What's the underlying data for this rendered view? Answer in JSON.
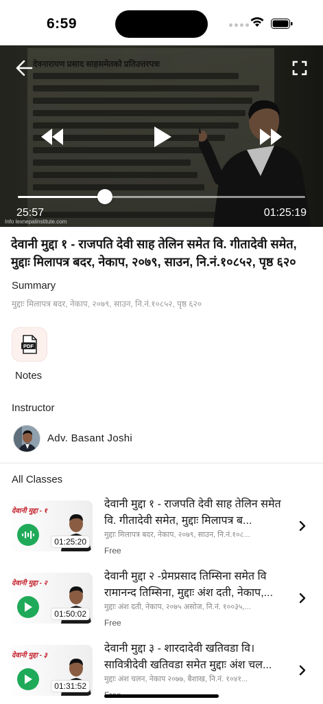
{
  "status_bar": {
    "time": "6:59"
  },
  "player": {
    "current_time": "25:57",
    "total_time": "01:25:19",
    "progress": 0.304,
    "watermark": "Info lexnepalinstitute.com",
    "doc_heading": "देवनारायण प्रसाद साहसमेतको प्रतिउत्तरपत्रः"
  },
  "lesson": {
    "title": "देवानी मुद्दा १ - राजपति देवी साह तेलिन समेत वि. गीतादेवी समेत, मुद्दाः मिलापत्र बदर, नेकाप, २०७९, साउन, नि.नं.१०८५२, पृष्ठ ६२०",
    "summary_label": "Summary",
    "summary_text": "मुद्दाः मिलापत्र बदर, नेकाप, २०७९, साउन, नि.नं.१०८५२, पृष्ठ ६२०",
    "notes_label": "Notes",
    "notes_icon": "pdf-icon",
    "instructor_label": "Instructor",
    "instructor_name": "Adv. Basant Joshi"
  },
  "all_classes": {
    "label": "All Classes",
    "items": [
      {
        "thumb_title": "देवानी मुद्दा - १",
        "duration": "01:25:20",
        "title": "देवानी मुद्दा १ - राजपति देवी साह तेलिन समेत वि. गीतादेवी समेत, मुद्दाः मिलापत्र ब...",
        "meta": "मुद्दाः मिलापत्र बदर, नेकाप, २०७९, साउन, नि.नं.१०८...",
        "price": "Free",
        "state": "playing",
        "icon": "audio-wave-icon"
      },
      {
        "thumb_title": "देवानी मुद्दा - २",
        "duration": "01:50:02",
        "title": "देवानी मुद्दा २ -प्रेमप्रसाद तिम्सिना समेत वि रामानन्द तिम्सिना, मुद्दाः अंश दती, नेकाप,...",
        "meta": "मुद्दाः अंश दती, नेकाप, २०७५ असोज, नि.नं. १००३५,...",
        "price": "Free",
        "state": "idle",
        "icon": "play-icon"
      },
      {
        "thumb_title": "देवानी मुद्दा - ३",
        "duration": "01:31:52",
        "title": "देवानी मुद्दा ३ - शारदादेवी खतिवडा वि। सावित्रीदेवी खतिवडा समेत मुद्दाः अंश चल...",
        "meta": "मुद्दाः अंश चलन, नेकाप २०७७, बैशाख, नि.नं. १०४१...",
        "price": "Free",
        "state": "idle",
        "icon": "play-icon"
      }
    ]
  },
  "colors": {
    "accent_green": "#1faa59",
    "thumb_title_red": "#c41e2a",
    "notes_bg": "#fdf1ee"
  }
}
